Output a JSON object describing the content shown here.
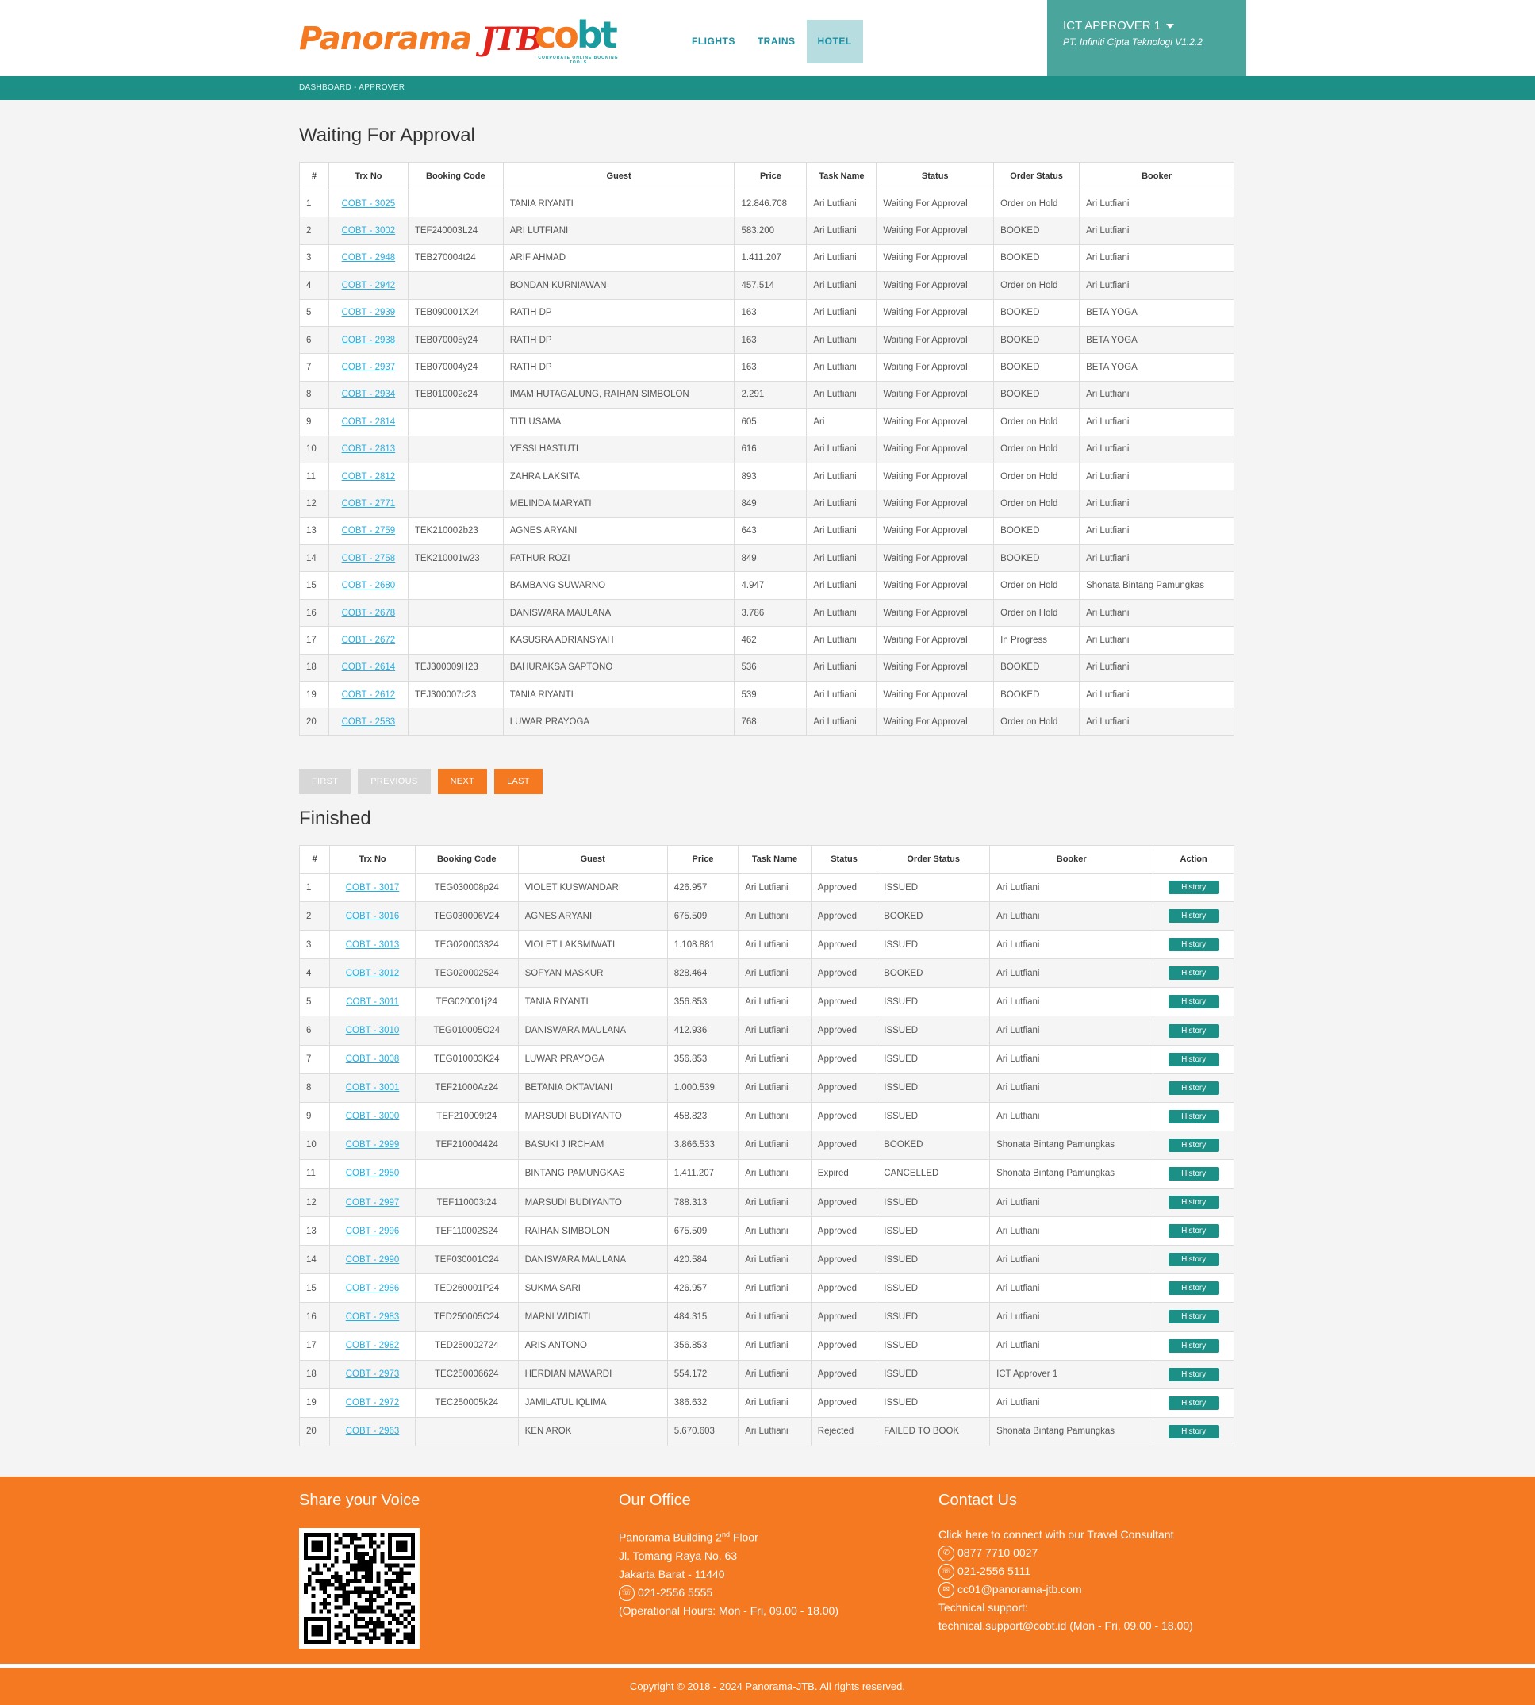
{
  "header": {
    "brand_word": "Panorama",
    "brand_mark": "JTB",
    "cobt_logo": "cobt",
    "cobt_tagline": "CORPORATE ONLINE BOOKING TOOLS",
    "nav": [
      "FLIGHTS",
      "TRAINS",
      "HOTEL"
    ],
    "active_nav": "HOTEL",
    "user_name": "ICT APPROVER 1",
    "company": "PT. Infiniti Cipta Teknologi V1.2.2"
  },
  "breadcrumb": "DASHBOARD - APPROVER",
  "waiting": {
    "title": "Waiting For Approval",
    "columns": [
      "#",
      "Trx No",
      "Booking Code",
      "Guest",
      "Price",
      "Task Name",
      "Status",
      "Order Status",
      "Booker"
    ],
    "rows": [
      [
        "1",
        "COBT - 3025",
        "",
        "TANIA RIYANTI",
        "12.846.708",
        "Ari Lutfiani",
        "Waiting For Approval",
        "Order on Hold",
        "Ari Lutfiani"
      ],
      [
        "2",
        "COBT - 3002",
        "TEF240003L24",
        "ARI LUTFIANI",
        "583.200",
        "Ari Lutfiani",
        "Waiting For Approval",
        "BOOKED",
        "Ari Lutfiani"
      ],
      [
        "3",
        "COBT - 2948",
        "TEB270004t24",
        "ARIF AHMAD",
        "1.411.207",
        "Ari Lutfiani",
        "Waiting For Approval",
        "BOOKED",
        "Ari Lutfiani"
      ],
      [
        "4",
        "COBT - 2942",
        "",
        "BONDAN KURNIAWAN",
        "457.514",
        "Ari Lutfiani",
        "Waiting For Approval",
        "Order on Hold",
        "Ari Lutfiani"
      ],
      [
        "5",
        "COBT - 2939",
        "TEB090001X24",
        "RATIH DP",
        "163",
        "Ari Lutfiani",
        "Waiting For Approval",
        "BOOKED",
        "BETA YOGA"
      ],
      [
        "6",
        "COBT - 2938",
        "TEB070005y24",
        "RATIH DP",
        "163",
        "Ari Lutfiani",
        "Waiting For Approval",
        "BOOKED",
        "BETA YOGA"
      ],
      [
        "7",
        "COBT - 2937",
        "TEB070004y24",
        "RATIH DP",
        "163",
        "Ari Lutfiani",
        "Waiting For Approval",
        "BOOKED",
        "BETA YOGA"
      ],
      [
        "8",
        "COBT - 2934",
        "TEB010002c24",
        "IMAM HUTAGALUNG, RAIHAN SIMBOLON",
        "2.291",
        "Ari Lutfiani",
        "Waiting For Approval",
        "BOOKED",
        "Ari Lutfiani"
      ],
      [
        "9",
        "COBT - 2814",
        "",
        "TITI USAMA",
        "605",
        "Ari",
        "Waiting For Approval",
        "Order on Hold",
        "Ari Lutfiani"
      ],
      [
        "10",
        "COBT - 2813",
        "",
        "YESSI HASTUTI",
        "616",
        "Ari Lutfiani",
        "Waiting For Approval",
        "Order on Hold",
        "Ari Lutfiani"
      ],
      [
        "11",
        "COBT - 2812",
        "",
        "ZAHRA LAKSITA",
        "893",
        "Ari Lutfiani",
        "Waiting For Approval",
        "Order on Hold",
        "Ari Lutfiani"
      ],
      [
        "12",
        "COBT - 2771",
        "",
        "MELINDA MARYATI",
        "849",
        "Ari Lutfiani",
        "Waiting For Approval",
        "Order on Hold",
        "Ari Lutfiani"
      ],
      [
        "13",
        "COBT - 2759",
        "TEK210002b23",
        "AGNES ARYANI",
        "643",
        "Ari Lutfiani",
        "Waiting For Approval",
        "BOOKED",
        "Ari Lutfiani"
      ],
      [
        "14",
        "COBT - 2758",
        "TEK210001w23",
        "FATHUR ROZI",
        "849",
        "Ari Lutfiani",
        "Waiting For Approval",
        "BOOKED",
        "Ari Lutfiani"
      ],
      [
        "15",
        "COBT - 2680",
        "",
        "BAMBANG SUWARNO",
        "4.947",
        "Ari Lutfiani",
        "Waiting For Approval",
        "Order on Hold",
        "Shonata Bintang Pamungkas"
      ],
      [
        "16",
        "COBT - 2678",
        "",
        "DANISWARA MAULANA",
        "3.786",
        "Ari Lutfiani",
        "Waiting For Approval",
        "Order on Hold",
        "Ari Lutfiani"
      ],
      [
        "17",
        "COBT - 2672",
        "",
        "KASUSRA ADRIANSYAH",
        "462",
        "Ari Lutfiani",
        "Waiting For Approval",
        "In Progress",
        "Ari Lutfiani"
      ],
      [
        "18",
        "COBT - 2614",
        "TEJ300009H23",
        "BAHURAKSA SAPTONO",
        "536",
        "Ari Lutfiani",
        "Waiting For Approval",
        "BOOKED",
        "Ari Lutfiani"
      ],
      [
        "19",
        "COBT - 2612",
        "TEJ300007c23",
        "TANIA RIYANTI",
        "539",
        "Ari Lutfiani",
        "Waiting For Approval",
        "BOOKED",
        "Ari Lutfiani"
      ],
      [
        "20",
        "COBT - 2583",
        "",
        "LUWAR PRAYOGA",
        "768",
        "Ari Lutfiani",
        "Waiting For Approval",
        "Order on Hold",
        "Ari Lutfiani"
      ]
    ]
  },
  "pager": {
    "first": "FIRST",
    "previous": "PREVIOUS",
    "next": "NEXT",
    "last": "LAST"
  },
  "finished": {
    "title": "Finished",
    "columns": [
      "#",
      "Trx No",
      "Booking Code",
      "Guest",
      "Price",
      "Task Name",
      "Status",
      "Order Status",
      "Booker",
      "Action"
    ],
    "action_label": "History",
    "rows": [
      [
        "1",
        "COBT - 3017",
        "TEG030008p24",
        "VIOLET KUSWANDARI",
        "426.957",
        "Ari Lutfiani",
        "Approved",
        "ISSUED",
        "Ari Lutfiani"
      ],
      [
        "2",
        "COBT - 3016",
        "TEG030006V24",
        "AGNES ARYANI",
        "675.509",
        "Ari Lutfiani",
        "Approved",
        "BOOKED",
        "Ari Lutfiani"
      ],
      [
        "3",
        "COBT - 3013",
        "TEG020003324",
        "VIOLET LAKSMIWATI",
        "1.108.881",
        "Ari Lutfiani",
        "Approved",
        "ISSUED",
        "Ari Lutfiani"
      ],
      [
        "4",
        "COBT - 3012",
        "TEG020002524",
        "SOFYAN MASKUR",
        "828.464",
        "Ari Lutfiani",
        "Approved",
        "BOOKED",
        "Ari Lutfiani"
      ],
      [
        "5",
        "COBT - 3011",
        "TEG020001j24",
        "TANIA RIYANTI",
        "356.853",
        "Ari Lutfiani",
        "Approved",
        "ISSUED",
        "Ari Lutfiani"
      ],
      [
        "6",
        "COBT - 3010",
        "TEG010005O24",
        "DANISWARA MAULANA",
        "412.936",
        "Ari Lutfiani",
        "Approved",
        "ISSUED",
        "Ari Lutfiani"
      ],
      [
        "7",
        "COBT - 3008",
        "TEG010003K24",
        "LUWAR PRAYOGA",
        "356.853",
        "Ari Lutfiani",
        "Approved",
        "ISSUED",
        "Ari Lutfiani"
      ],
      [
        "8",
        "COBT - 3001",
        "TEF21000Az24",
        "BETANIA OKTAVIANI",
        "1.000.539",
        "Ari Lutfiani",
        "Approved",
        "ISSUED",
        "Ari Lutfiani"
      ],
      [
        "9",
        "COBT - 3000",
        "TEF210009t24",
        "MARSUDI BUDIYANTO",
        "458.823",
        "Ari Lutfiani",
        "Approved",
        "ISSUED",
        "Ari Lutfiani"
      ],
      [
        "10",
        "COBT - 2999",
        "TEF210004424",
        "BASUKI J IRCHAM",
        "3.866.533",
        "Ari Lutfiani",
        "Approved",
        "BOOKED",
        "Shonata Bintang Pamungkas"
      ],
      [
        "11",
        "COBT - 2950",
        "",
        "BINTANG PAMUNGKAS",
        "1.411.207",
        "Ari Lutfiani",
        "Expired",
        "CANCELLED",
        "Shonata Bintang Pamungkas"
      ],
      [
        "12",
        "COBT - 2997",
        "TEF110003t24",
        "MARSUDI BUDIYANTO",
        "788.313",
        "Ari Lutfiani",
        "Approved",
        "ISSUED",
        "Ari Lutfiani"
      ],
      [
        "13",
        "COBT - 2996",
        "TEF110002S24",
        "RAIHAN SIMBOLON",
        "675.509",
        "Ari Lutfiani",
        "Approved",
        "ISSUED",
        "Ari Lutfiani"
      ],
      [
        "14",
        "COBT - 2990",
        "TEF030001C24",
        "DANISWARA MAULANA",
        "420.584",
        "Ari Lutfiani",
        "Approved",
        "ISSUED",
        "Ari Lutfiani"
      ],
      [
        "15",
        "COBT - 2986",
        "TED260001P24",
        "SUKMA SARI",
        "426.957",
        "Ari Lutfiani",
        "Approved",
        "ISSUED",
        "Ari Lutfiani"
      ],
      [
        "16",
        "COBT - 2983",
        "TED250005C24",
        "MARNI WIDIATI",
        "484.315",
        "Ari Lutfiani",
        "Approved",
        "ISSUED",
        "Ari Lutfiani"
      ],
      [
        "17",
        "COBT - 2982",
        "TED250002724",
        "ARIS ANTONO",
        "356.853",
        "Ari Lutfiani",
        "Approved",
        "ISSUED",
        "Ari Lutfiani"
      ],
      [
        "18",
        "COBT - 2973",
        "TEC250006624",
        "HERDIAN MAWARDI",
        "554.172",
        "Ari Lutfiani",
        "Approved",
        "ISSUED",
        "ICT Approver 1"
      ],
      [
        "19",
        "COBT - 2972",
        "TEC250005k24",
        "JAMILATUL IQLIMA",
        "386.632",
        "Ari Lutfiani",
        "Approved",
        "ISSUED",
        "Ari Lutfiani"
      ],
      [
        "20",
        "COBT - 2963",
        "",
        "KEN AROK",
        "5.670.603",
        "Ari Lutfiani",
        "Rejected",
        "FAILED TO BOOK",
        "Shonata Bintang Pamungkas"
      ]
    ]
  },
  "footer": {
    "voice_title": "Share your Voice",
    "office_title": "Our Office",
    "office_line1_pre": "Panorama Building 2",
    "office_line1_sup": "nd",
    "office_line1_post": " Floor",
    "office_line2": "Jl. Tomang Raya No. 63",
    "office_line3": "Jakarta Barat - 11440",
    "office_phone": "021-2556 5555",
    "office_hours": "(Operational Hours: Mon - Fri, 09.00 - 18.00)",
    "contact_title": "Contact Us",
    "contact_link": "Click here to connect with our Travel Consultant",
    "contact_whatsapp": "0877 7710 0027",
    "contact_phone": "021-2556 5111",
    "contact_email": "cc01@panorama-jtb.com",
    "tech_label": "Technical support:",
    "tech_line": "technical.support@cobt.id (Mon - Fri, 09.00 - 18.00)",
    "copyright": "Copyright © 2018 - 2024 Panorama-JTB. All rights reserved."
  },
  "colors": {
    "teal": "#1c8f86",
    "orange": "#f47920",
    "link": "#27aee0"
  }
}
